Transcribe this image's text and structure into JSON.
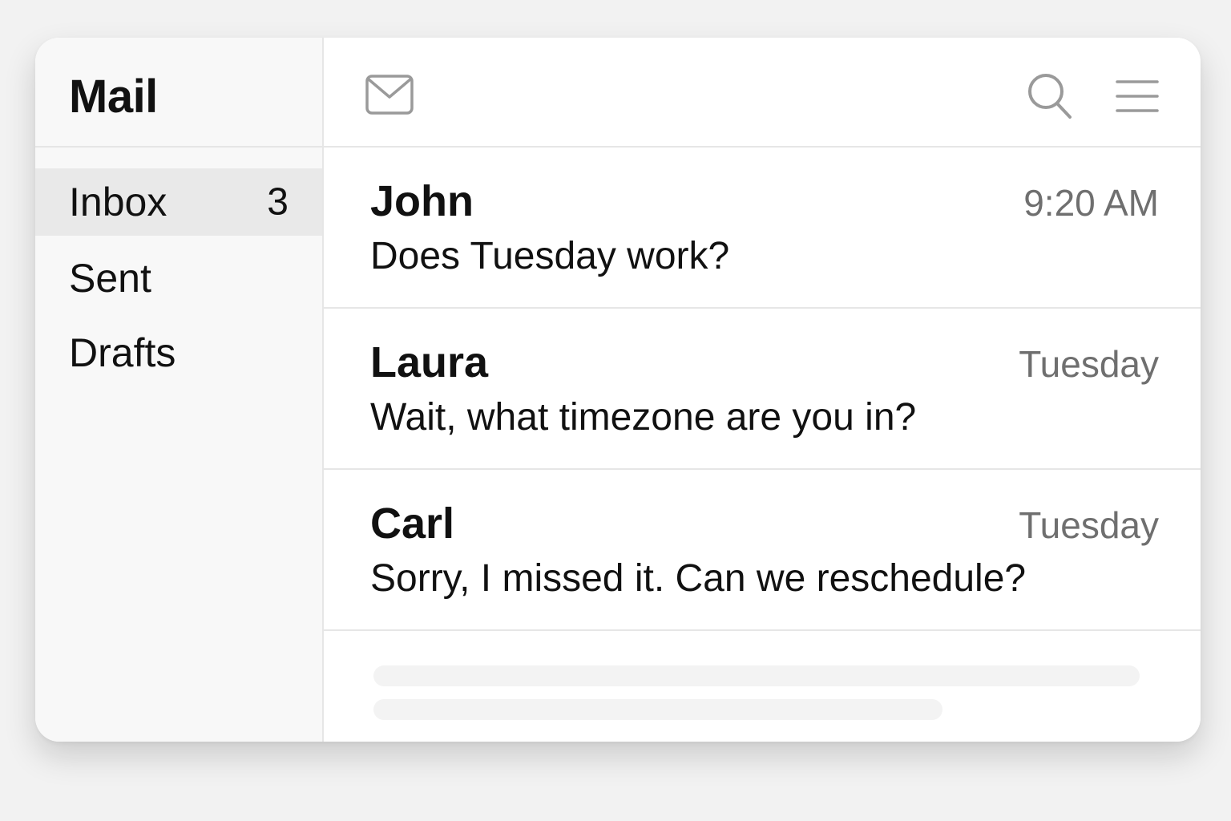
{
  "app": {
    "title": "Mail"
  },
  "sidebar": {
    "folders": [
      {
        "label": "Inbox",
        "count": "3",
        "selected": true
      },
      {
        "label": "Sent",
        "count": ""
      },
      {
        "label": "Drafts",
        "count": ""
      }
    ]
  },
  "toolbar": {
    "icons": [
      "mail-icon",
      "search-icon",
      "menu-icon"
    ]
  },
  "messages": [
    {
      "sender": "John",
      "time": "9:20 AM",
      "preview": "Does Tuesday work?"
    },
    {
      "sender": "Laura",
      "time": "Tuesday",
      "preview": "Wait, what timezone are you in?"
    },
    {
      "sender": "Carl",
      "time": "Tuesday",
      "preview": "Sorry, I missed it. Can we reschedule?"
    }
  ],
  "colors": {
    "background": "#f2f2f2",
    "window": "#ffffff",
    "sidebar": "#f8f8f8",
    "selected": "#e9e9e9",
    "divider": "#e6e6e6",
    "secondary_text": "#6f6f6f",
    "icon": "#9a9a9a"
  }
}
